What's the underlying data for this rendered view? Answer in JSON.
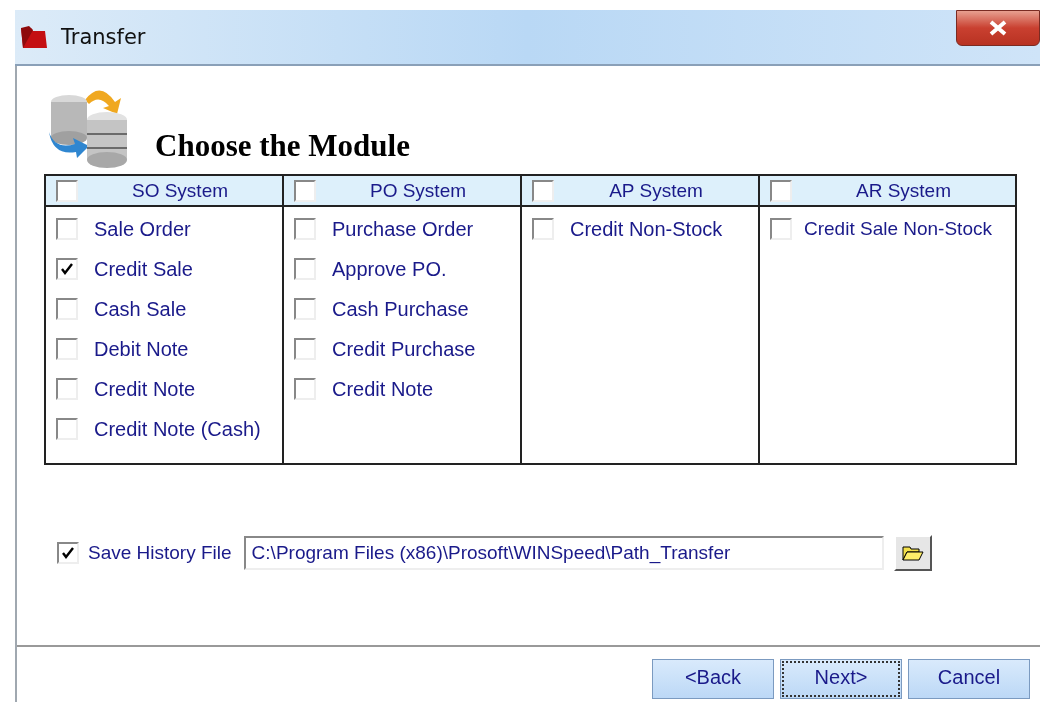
{
  "window": {
    "title": "Transfer"
  },
  "heading": "Choose the Module",
  "modules": [
    {
      "label": "SO System",
      "checked": false,
      "options": [
        {
          "label": "Sale Order",
          "checked": false
        },
        {
          "label": "Credit Sale",
          "checked": true
        },
        {
          "label": "Cash Sale",
          "checked": false
        },
        {
          "label": "Debit Note",
          "checked": false
        },
        {
          "label": "Credit Note",
          "checked": false
        },
        {
          "label": "Credit Note (Cash)",
          "checked": false
        }
      ]
    },
    {
      "label": "PO System",
      "checked": false,
      "options": [
        {
          "label": "Purchase Order",
          "checked": false
        },
        {
          "label": "Approve PO.",
          "checked": false
        },
        {
          "label": "Cash Purchase",
          "checked": false
        },
        {
          "label": "Credit Purchase",
          "checked": false
        },
        {
          "label": "Credit Note",
          "checked": false
        }
      ]
    },
    {
      "label": "AP System",
      "checked": false,
      "options": [
        {
          "label": "Credit Non-Stock",
          "checked": false
        }
      ]
    },
    {
      "label": "AR System",
      "checked": false,
      "options": [
        {
          "label": "Credit Sale Non-Stock",
          "checked": false
        }
      ]
    }
  ],
  "history": {
    "label": "Save History File",
    "checked": true,
    "value": "C:\\Program Files (x86)\\Prosoft\\WINSpeed\\Path_Transfer"
  },
  "buttons": [
    {
      "label": "<Back",
      "focused": false
    },
    {
      "label": "Next>",
      "focused": true
    },
    {
      "label": "Cancel",
      "focused": false
    }
  ]
}
